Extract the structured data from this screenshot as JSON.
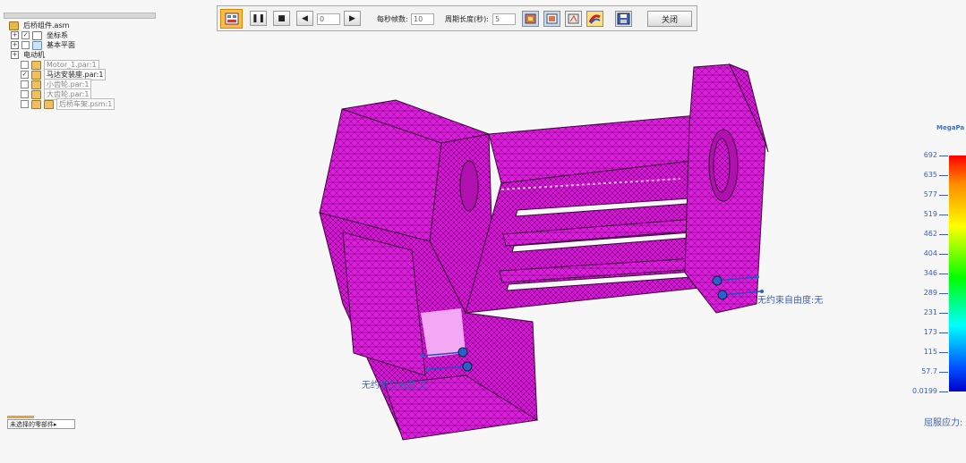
{
  "tree": {
    "items": [
      {
        "label": "后桥组件.asm"
      },
      {
        "label": "坐标系"
      },
      {
        "label": "基本平面"
      },
      {
        "label": "电动机"
      },
      {
        "label": "Motor_1.par:1"
      },
      {
        "label": "马达安装座.par:1"
      },
      {
        "label": "小齿轮.par:1"
      },
      {
        "label": "大齿轮.par:1"
      },
      {
        "label": "后桥车架.psm:1"
      }
    ]
  },
  "toolbar": {
    "frame_value": "0",
    "frames_per_sec_label": "每秒帧数:",
    "frames_per_sec_value": "10",
    "period_label": "周期长度(秒):",
    "period_value": "5",
    "close_label": "关闭"
  },
  "annotations": {
    "right_constraint": "无约束自由度:无",
    "left_constraint": "无约束自由度:无"
  },
  "legend": {
    "title": "MegaPa",
    "ticks": [
      "692",
      "635",
      "577",
      "519",
      "462",
      "404",
      "346",
      "289",
      "231",
      "173",
      "115",
      "57.7",
      "0.0199"
    ],
    "caption": "屈服应力:"
  },
  "selector": {
    "label": "未选择的零部件▸"
  },
  "colors": {
    "mesh": "#e01ce0",
    "accent": "#3a6fd0"
  }
}
